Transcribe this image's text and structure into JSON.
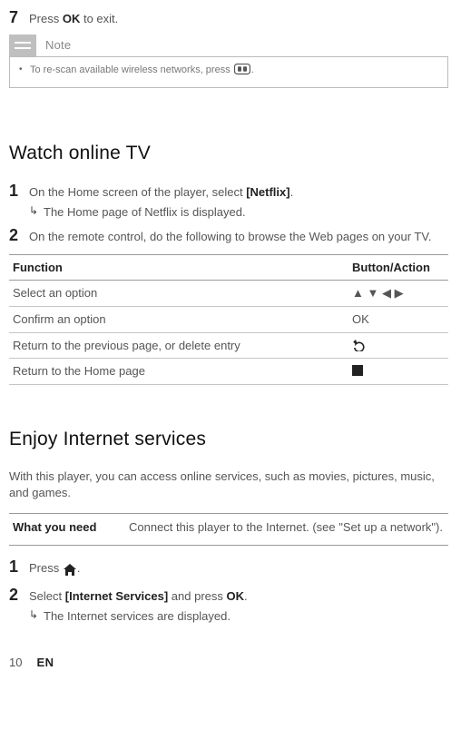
{
  "step7": {
    "num": "7",
    "text_a": "Press ",
    "text_b": "OK",
    "text_c": " to exit."
  },
  "note": {
    "label": "Note",
    "item_a": "To re-scan available wireless networks, press ",
    "item_b": "."
  },
  "watch": {
    "heading": "Watch online TV",
    "s1": {
      "num": "1",
      "a": "On the Home screen of the player, select ",
      "b": "[Netflix]",
      "c": ".",
      "sub": "The Home page of Netflix is displayed."
    },
    "s2": {
      "num": "2",
      "a": "On the remote control, do the following to browse the Web pages on your TV."
    },
    "table": {
      "h1": "Function",
      "h2": "Button/Action",
      "r1f": "Select an option",
      "r2f": "Confirm an option",
      "r2a": "OK",
      "r3f": "Return to the previous page, or delete entry",
      "r4f": "Return to the Home page"
    }
  },
  "enjoy": {
    "heading": "Enjoy Internet services",
    "intro": "With this player, you can access online services, such as movies, pictures, music, and games.",
    "need_label": "What you need",
    "need_text": "Connect this player to the Internet. (see \"Set up a network\").",
    "s1": {
      "num": "1",
      "a": "Press ",
      "b": "."
    },
    "s2": {
      "num": "2",
      "a": "Select ",
      "b": "[Internet Services]",
      "c": " and press ",
      "d": "OK",
      "e": ".",
      "sub": "The Internet services are displayed."
    }
  },
  "footer": {
    "page": "10",
    "lang": "EN"
  }
}
